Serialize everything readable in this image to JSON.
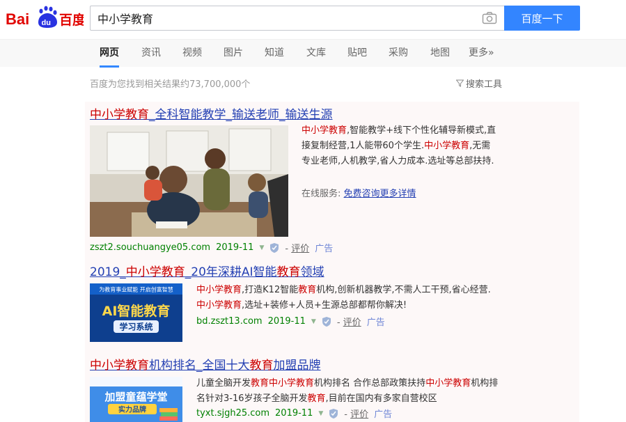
{
  "search": {
    "query": "中小学教育",
    "button_label": "百度一下"
  },
  "colors": {
    "accent": "#3385ff",
    "title_link": "#2440b3",
    "highlight": "#cc0000",
    "url_green": "#008000"
  },
  "tabs": [
    {
      "label": "网页",
      "active": true
    },
    {
      "label": "资讯"
    },
    {
      "label": "视频"
    },
    {
      "label": "图片"
    },
    {
      "label": "知道"
    },
    {
      "label": "文库"
    },
    {
      "label": "贴吧"
    },
    {
      "label": "采购"
    },
    {
      "label": "地图"
    },
    {
      "label": "更多»"
    }
  ],
  "result_count": "百度为您找到相关结果约73,700,000个",
  "tools_label": "搜索工具",
  "results": [
    {
      "title_parts": [
        {
          "text": "中小学教育",
          "hl": true
        },
        {
          "text": "_全科智能教学_输送老师_输送生源",
          "hl": false
        }
      ],
      "desc_parts": [
        {
          "text": "中小学教育",
          "hl": true
        },
        {
          "text": ",智能教学+线下个性化辅导新模式,直接复制经营,1人能带60个学生.",
          "hl": false
        },
        {
          "text": "中小学教育",
          "hl": true
        },
        {
          "text": ",无需专业老师,人机教学,省人力成本.选址等总部扶持.",
          "hl": false
        }
      ],
      "service_label": "在线服务:",
      "service_link": "免费咨询更多详情",
      "url": "zszt2.souchuangye05.com",
      "date": "2019-11",
      "review": "评价",
      "ad": "广告"
    },
    {
      "title_parts": [
        {
          "text": "2019_",
          "hl": false
        },
        {
          "text": "中小学教育",
          "hl": true
        },
        {
          "text": "_20年深耕AI智能",
          "hl": false
        },
        {
          "text": "教育",
          "hl": true
        },
        {
          "text": "领域",
          "hl": false
        }
      ],
      "desc_parts": [
        {
          "text": "中小学教育",
          "hl": true
        },
        {
          "text": ",打造K12智能",
          "hl": false
        },
        {
          "text": "教育",
          "hl": true
        },
        {
          "text": "机构,创新机器教学,不需人工干预,省心经营.",
          "hl": false
        },
        {
          "text": "中小学教育",
          "hl": true
        },
        {
          "text": ",选址+装修+人员+生源总部都帮你解决!",
          "hl": false
        }
      ],
      "image_banner": "为教育事业赋能  开启创富智慧",
      "image_title": "AI智能教育",
      "image_sub": "学习系统",
      "url": "bd.zszt13.com",
      "date": "2019-11",
      "review": "评价",
      "ad": "广告"
    },
    {
      "title_parts": [
        {
          "text": "中小学教育",
          "hl": true
        },
        {
          "text": "机构排名_全国十大",
          "hl": false
        },
        {
          "text": "教育",
          "hl": true
        },
        {
          "text": "加盟品牌",
          "hl": false
        }
      ],
      "desc_parts": [
        {
          "text": "儿童全脑开发",
          "hl": false
        },
        {
          "text": "教育",
          "hl": true
        },
        {
          "text": "中小学教育",
          "hl": true
        },
        {
          "text": "机构排名 合作总部政策扶持",
          "hl": false
        },
        {
          "text": "中小学教育",
          "hl": true
        },
        {
          "text": "机构排名针对3-16岁孩子全脑开发",
          "hl": false
        },
        {
          "text": "教育",
          "hl": true
        },
        {
          "text": ",目前在国内有多家自营校区",
          "hl": false
        }
      ],
      "image_title": "加盟童蕴学堂",
      "image_sub": "实力品牌",
      "url": "tyxt.sjgh25.com",
      "date": "2019-11",
      "review": "评价",
      "ad": "广告"
    }
  ]
}
